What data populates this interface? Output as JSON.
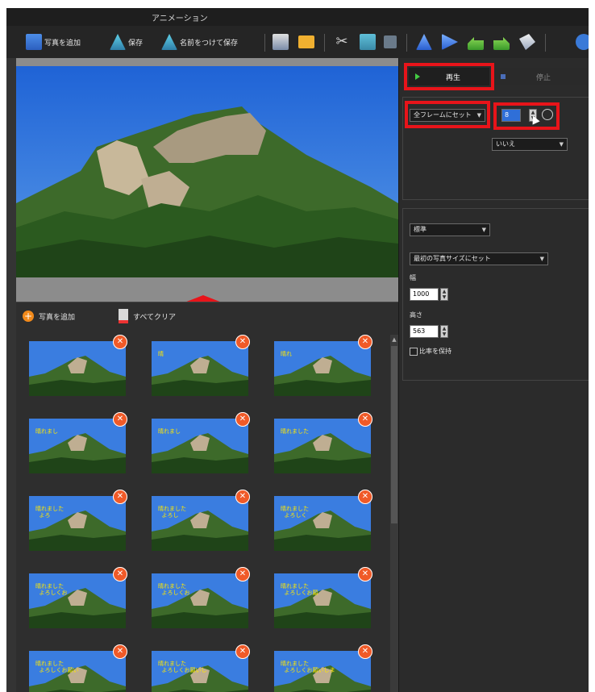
{
  "window": {
    "title": "アニメーション"
  },
  "toolbar": {
    "add_photo_label": "写真を追加",
    "save_label": "保存",
    "save_as_label": "名前をつけて保存"
  },
  "strip": {
    "add_label": "写真を追加",
    "clear_label": "すべてクリア",
    "thumbnails": [
      {
        "caption": ""
      },
      {
        "caption": "晴"
      },
      {
        "caption": "晴れ"
      },
      {
        "caption": "晴れまし"
      },
      {
        "caption": "晴れまし"
      },
      {
        "caption": "晴れました"
      },
      {
        "caption": "晴れました\n  よろ"
      },
      {
        "caption": "晴れました\n  よろし"
      },
      {
        "caption": "晴れました\n  よろしく"
      },
      {
        "caption": "晴れました\n  よろしくお"
      },
      {
        "caption": "晴れました\n  よろしくお"
      },
      {
        "caption": "晴れました\n  よろしくお願"
      },
      {
        "caption": "晴れました\n  よろしくお願い"
      },
      {
        "caption": "晴れました\n  よろしくお願いし"
      },
      {
        "caption": "晴れました\n  よろしくお願いしま"
      }
    ]
  },
  "right": {
    "play_label": "再生",
    "stop_label": "停止",
    "frame_dropdown": "全フレームにセット",
    "frame_value": "8",
    "loop_dropdown": "いいえ",
    "size_mode_dropdown": "標準",
    "size_set_dropdown": "最初の写真サイズにセット",
    "width_label": "幅",
    "width_value": "1000",
    "height_label": "高さ",
    "height_value": "563",
    "keep_ratio_label": "比率を保持"
  },
  "colors": {
    "highlight": "#e8141a",
    "accent_orange": "#f28a1b",
    "background": "#2b2b2b"
  }
}
